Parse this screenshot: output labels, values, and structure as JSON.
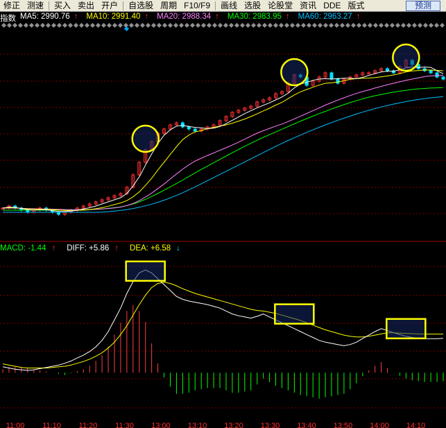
{
  "toolbar": {
    "items": [
      "修正",
      "测速",
      "买入",
      "卖出",
      "开户",
      "自选股",
      "周期",
      "F10/F9",
      "画线",
      "选股",
      "论股堂",
      "资讯",
      "DDE",
      "版式"
    ],
    "predict_label": "预测"
  },
  "legend": {
    "index_name": "指数",
    "ma5": "MA5: 2990.76",
    "ma5_arrow": "↑",
    "ma10": "MA10: 2991.40",
    "ma10_arrow": "↑",
    "ma20": "MA20: 2988.34",
    "ma20_arrow": "↑",
    "ma30": "MA30: 2983.95",
    "ma30_arrow": "↑",
    "ma60": "MA60: 2963.27",
    "ma60_arrow": "↑"
  },
  "macd_legend": {
    "macd": "MACD: -1.44",
    "macd_arrow": "↑",
    "diff": "DIFF: +5.86",
    "diff_arrow": "↑",
    "dea": "DEA: +6.58",
    "dea_arrow": "↓"
  },
  "colors": {
    "ma5": "#ffffff",
    "ma10": "#ffff00",
    "ma20": "#ff80ff",
    "ma30": "#00ff00",
    "ma60": "#00c0ff",
    "up": "#ff3030",
    "down": "#00e0ff",
    "macd_pos": "#ff4040",
    "macd_neg": "#00ff00",
    "highlight": "#ffff00",
    "grid": "#800000"
  },
  "chart_data": {
    "type": "candlestick+macd",
    "time_labels": [
      "11:00",
      "11:10",
      "11:20",
      "11:30",
      "13:00",
      "13:10",
      "13:20",
      "13:30",
      "13:40",
      "13:50",
      "14:00",
      "14:10"
    ],
    "price": {
      "candles_close": [
        2930,
        2931,
        2930,
        2929,
        2928,
        2929,
        2930,
        2929,
        2928,
        2927,
        2928,
        2929,
        2930,
        2931,
        2932,
        2933,
        2934,
        2935,
        2936,
        2937,
        2940,
        2946,
        2952,
        2958,
        2962,
        2966,
        2968,
        2970,
        2971,
        2969,
        2968,
        2967,
        2968,
        2969,
        2970,
        2972,
        2974,
        2976,
        2977,
        2978,
        2979,
        2981,
        2982,
        2983,
        2985,
        2986,
        2990,
        2994,
        2993,
        2989,
        2991,
        2993,
        2995,
        2992,
        2990,
        2992,
        2993,
        2994,
        2995,
        2995,
        2996,
        2997,
        2996,
        2995,
        2998,
        3001,
        2999,
        2997,
        2996,
        2995,
        2993,
        2992
      ],
      "ma5": [
        2930,
        2930.5,
        2930.3,
        2929.8,
        2929.2,
        2929,
        2929.2,
        2929.2,
        2928.8,
        2928.4,
        2928.4,
        2928.6,
        2929,
        2929.6,
        2930.2,
        2931,
        2932,
        2933,
        2934,
        2935,
        2937,
        2940.6,
        2945,
        2950.6,
        2956,
        2961,
        2965,
        2967.6,
        2969.4,
        2969.8,
        2969.2,
        2968.8,
        2968.6,
        2968.2,
        2968.4,
        2969.2,
        2970.6,
        2972.2,
        2973.8,
        2975.4,
        2976.8,
        2978.2,
        2979.4,
        2980.6,
        2982,
        2983.4,
        2985.2,
        2987.8,
        2989.6,
        2990.4,
        2991.4,
        2992,
        2992.2,
        2992,
        2992.2,
        2992.4,
        2992.4,
        2992.2,
        2992.8,
        2993.8,
        2994.6,
        2995.4,
        2995.8,
        2995.8,
        2996.4,
        2997.4,
        2997.8,
        2997.6,
        2997.8,
        2997.6,
        2996,
        2994.6
      ],
      "ma10": [
        2930,
        2930.2,
        2930.1,
        2929.9,
        2929.6,
        2929.5,
        2929.5,
        2929.4,
        2929.3,
        2929.1,
        2928.9,
        2928.8,
        2928.9,
        2929.1,
        2929.3,
        2929.7,
        2930.2,
        2930.9,
        2931.7,
        2932.5,
        2933.6,
        2935.4,
        2937.8,
        2940.9,
        2944.3,
        2948.3,
        2952,
        2955.8,
        2959.5,
        2962.9,
        2965.1,
        2966.6,
        2967.3,
        2968.2,
        2968.8,
        2969.4,
        2970,
        2970.8,
        2971.8,
        2972.8,
        2974,
        2975.3,
        2976.7,
        2978,
        2979.5,
        2980.8,
        2982.6,
        2984.4,
        2985.9,
        2987,
        2988.1,
        2989.1,
        2990,
        2990.2,
        2990.6,
        2991.2,
        2991.9,
        2992.2,
        2992.4,
        2992.5,
        2992.7,
        2993.1,
        2993.5,
        2994,
        2994.6,
        2995.4,
        2995.9,
        2996.1,
        2996.4,
        2996.3,
        2996.2,
        2996
      ],
      "ma20": [
        2930,
        2930,
        2930,
        2929.9,
        2929.8,
        2929.7,
        2929.6,
        2929.6,
        2929.5,
        2929.4,
        2929.3,
        2929.2,
        2929.2,
        2929.2,
        2929.3,
        2929.4,
        2929.6,
        2929.8,
        2930.1,
        2930.5,
        2931.2,
        2932.2,
        2933.6,
        2935.3,
        2937.2,
        2939.4,
        2941.6,
        2944,
        2946.4,
        2948.7,
        2950.8,
        2952.6,
        2954,
        2955.3,
        2956.5,
        2957.8,
        2959,
        2960.3,
        2961.7,
        2963.1,
        2964.6,
        2966,
        2967.2,
        2968.3,
        2969.4,
        2970.4,
        2971.6,
        2972.9,
        2974.2,
        2975.5,
        2976.8,
        2978.1,
        2979.5,
        2980.7,
        2981.9,
        2983,
        2984.1,
        2985.1,
        2986,
        2986.8,
        2987.7,
        2988.5,
        2989.3,
        2990,
        2990.7,
        2991.4,
        2992,
        2992.6,
        2993.2,
        2993.5,
        2993.7,
        2993.9
      ],
      "ma30": [
        2929,
        2929,
        2929,
        2929,
        2929,
        2929,
        2929,
        2929,
        2929,
        2929,
        2929,
        2929,
        2929,
        2929,
        2929.2,
        2929.4,
        2929.6,
        2929.9,
        2930.2,
        2930.6,
        2931.2,
        2932,
        2933,
        2934.2,
        2935.6,
        2937,
        2938.6,
        2940.2,
        2941.8,
        2943.5,
        2945.2,
        2946.9,
        2948.6,
        2950.2,
        2951.8,
        2953.4,
        2955,
        2956.6,
        2958.2,
        2959.7,
        2961.2,
        2962.6,
        2964,
        2965.3,
        2966.6,
        2967.9,
        2969.2,
        2970.5,
        2971.8,
        2973,
        2974.2,
        2975.4,
        2976.5,
        2977.6,
        2978.7,
        2979.7,
        2980.7,
        2981.6,
        2982.5,
        2983.3,
        2984,
        2984.6,
        2985.2,
        2985.7,
        2986.2,
        2986.6,
        2987,
        2987.3,
        2987.5,
        2987.7,
        2987.8,
        2987.9
      ],
      "ma60": [
        2928,
        2928,
        2928,
        2928,
        2928,
        2928,
        2928,
        2928,
        2928,
        2928,
        2928,
        2928,
        2928,
        2928,
        2928,
        2928,
        2928.1,
        2928.3,
        2928.6,
        2928.9,
        2929.3,
        2929.8,
        2930.4,
        2931.1,
        2931.9,
        2932.8,
        2933.8,
        2934.9,
        2936.1,
        2937.4,
        2938.8,
        2940.2,
        2941.7,
        2943.2,
        2944.7,
        2946.2,
        2947.7,
        2949.2,
        2950.7,
        2952.2,
        2953.7,
        2955.2,
        2956.7,
        2958.2,
        2959.7,
        2961.1,
        2962.5,
        2963.8,
        2965.1,
        2966.4,
        2967.6,
        2968.8,
        2970,
        2971.1,
        2972.2,
        2973.2,
        2974.2,
        2975.2,
        2976.1,
        2977,
        2977.8,
        2978.6,
        2979.3,
        2980,
        2980.6,
        2981.2,
        2981.7,
        2982.2,
        2982.6,
        2983,
        2983.3,
        2983.6
      ],
      "ylim": [
        2920,
        3010
      ]
    },
    "macd": {
      "diff": [
        1,
        0.8,
        0.6,
        0.5,
        0.4,
        0.5,
        0.7,
        0.9,
        1.1,
        1.3,
        1.6,
        2,
        2.5,
        3,
        3.6,
        4.4,
        5.5,
        7,
        9,
        11,
        13.5,
        15.5,
        17,
        17.5,
        17,
        16,
        15,
        14,
        13,
        12.5,
        12.2,
        12,
        11.8,
        11.6,
        11.3,
        11,
        10.5,
        10,
        9.7,
        9.5,
        9.3,
        9.6,
        10,
        9.5,
        9,
        8.5,
        8,
        7.5,
        7,
        6.5,
        6,
        5.5,
        5.2,
        5,
        4.8,
        4.6,
        4.8,
        5.2,
        5.8,
        6.4,
        7,
        7.5,
        7.2,
        6.8,
        6.5,
        6.2,
        6,
        5.86,
        5.8,
        5.8,
        5.8,
        5.86
      ],
      "dea": [
        1.5,
        1.3,
        1.1,
        0.9,
        0.8,
        0.8,
        0.8,
        0.8,
        0.9,
        1,
        1.1,
        1.3,
        1.6,
        1.9,
        2.3,
        2.8,
        3.4,
        4.2,
        5.2,
        6.5,
        8,
        9.8,
        11.6,
        13.2,
        14.5,
        15.2,
        15.4,
        15.2,
        14.8,
        14.3,
        13.9,
        13.5,
        13.2,
        12.9,
        12.6,
        12.3,
        12,
        11.7,
        11.4,
        11.1,
        10.8,
        10.6,
        10.5,
        10.3,
        10.1,
        9.8,
        9.5,
        9.2,
        8.9,
        8.5,
        8.1,
        7.7,
        7.3,
        7,
        6.7,
        6.4,
        6.2,
        6.1,
        6.1,
        6.2,
        6.4,
        6.6,
        6.8,
        6.8,
        6.75,
        6.7,
        6.65,
        6.6,
        6.58,
        6.58,
        6.58,
        6.58
      ],
      "hist": [
        0.6,
        0.9,
        1,
        1,
        0.8,
        0.6,
        0.4,
        0.2,
        0,
        -0.2,
        -0.4,
        -0.1,
        0.3,
        0.6,
        1.2,
        2,
        3,
        4.5,
        6.5,
        8.5,
        10.5,
        11.5,
        10.5,
        8.6,
        5,
        1.6,
        -0.8,
        -2.4,
        -3.6,
        -3.6,
        -3.4,
        -3,
        -2.8,
        -2.6,
        -2.6,
        -2.6,
        -3,
        -3.4,
        -3.4,
        -3.2,
        -3,
        -2,
        -1,
        -1.6,
        -2.2,
        -2.6,
        -3,
        -3.4,
        -3.8,
        -4,
        -4.2,
        -4.4,
        -4.2,
        -4,
        -3.8,
        -3.6,
        -2.8,
        -1.8,
        -0.6,
        0.4,
        1.2,
        1.8,
        0.8,
        0,
        -0.5,
        -1,
        -1.3,
        -1.44,
        -1.56,
        -1.56,
        -1.56,
        -1.44
      ],
      "ylim": [
        -8,
        20
      ]
    }
  }
}
